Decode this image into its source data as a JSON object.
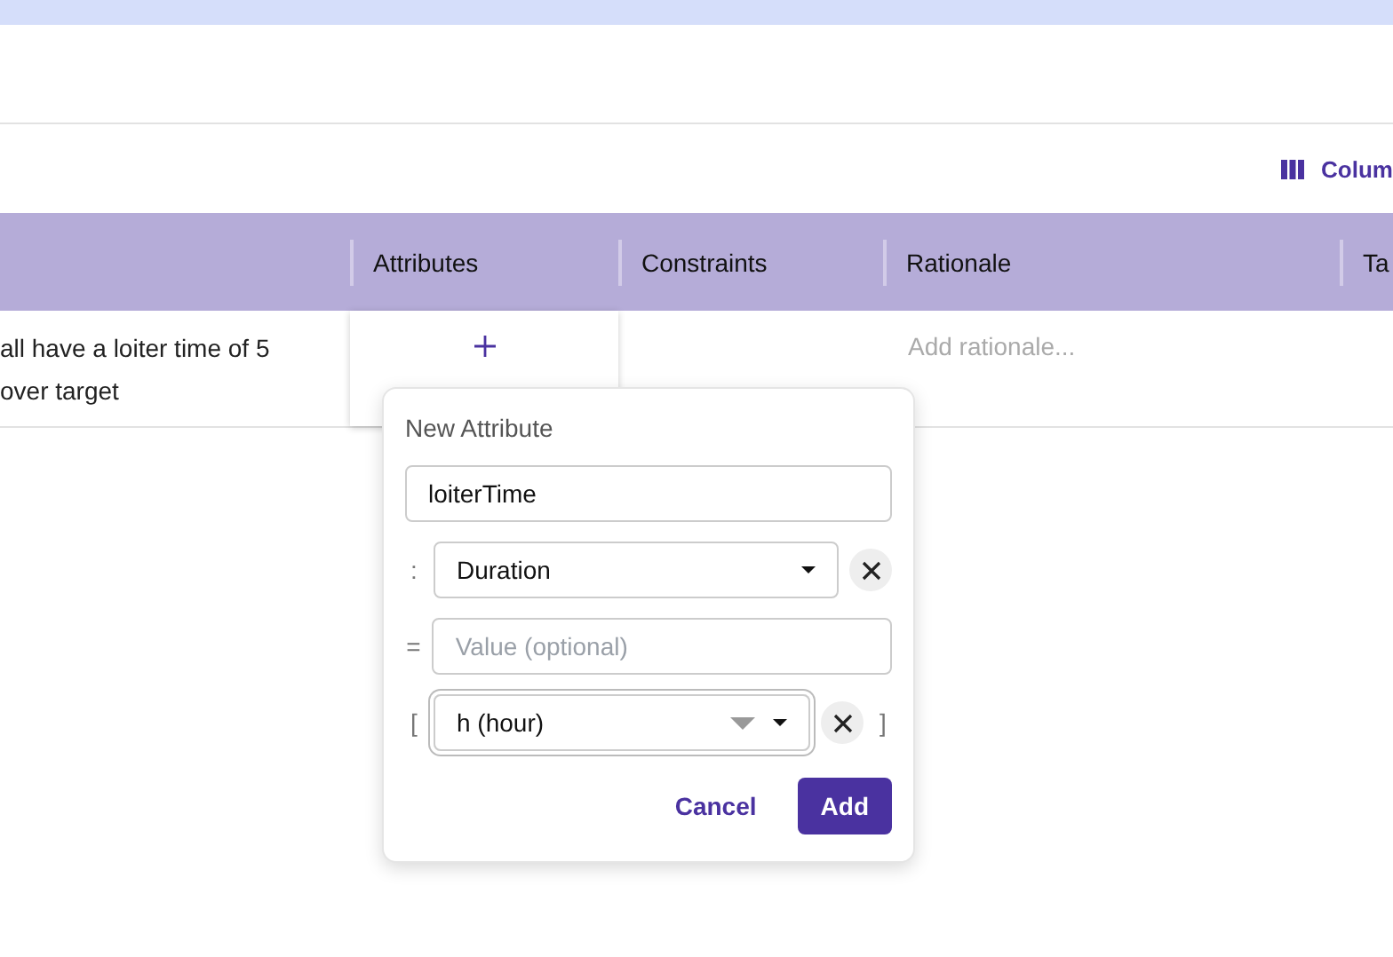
{
  "toolbar": {
    "columns_button": "Colum"
  },
  "table": {
    "columns": [
      {},
      {
        "label": "Attributes"
      },
      {
        "label": "Constraints"
      },
      {
        "label": "Rationale"
      },
      {
        "label": "Ta"
      }
    ],
    "rows": [
      {
        "requirement_lines": [
          "all have a loiter time of 5",
          "over target"
        ],
        "rationale_placeholder": "Add rationale..."
      }
    ]
  },
  "popover": {
    "title": "New Attribute",
    "name_field": {
      "value": "loiterTime"
    },
    "type_row": {
      "prefix": ":",
      "value": "Duration",
      "clearable": true
    },
    "value_row": {
      "prefix": "=",
      "placeholder": "Value (optional)"
    },
    "unit_row": {
      "prefix": "[",
      "suffix": "]",
      "value": "h (hour)",
      "clearable": true,
      "focused": true
    },
    "buttons": [
      {
        "label": "Cancel",
        "kind": "secondary"
      },
      {
        "label": "Add",
        "kind": "primary"
      }
    ]
  }
}
